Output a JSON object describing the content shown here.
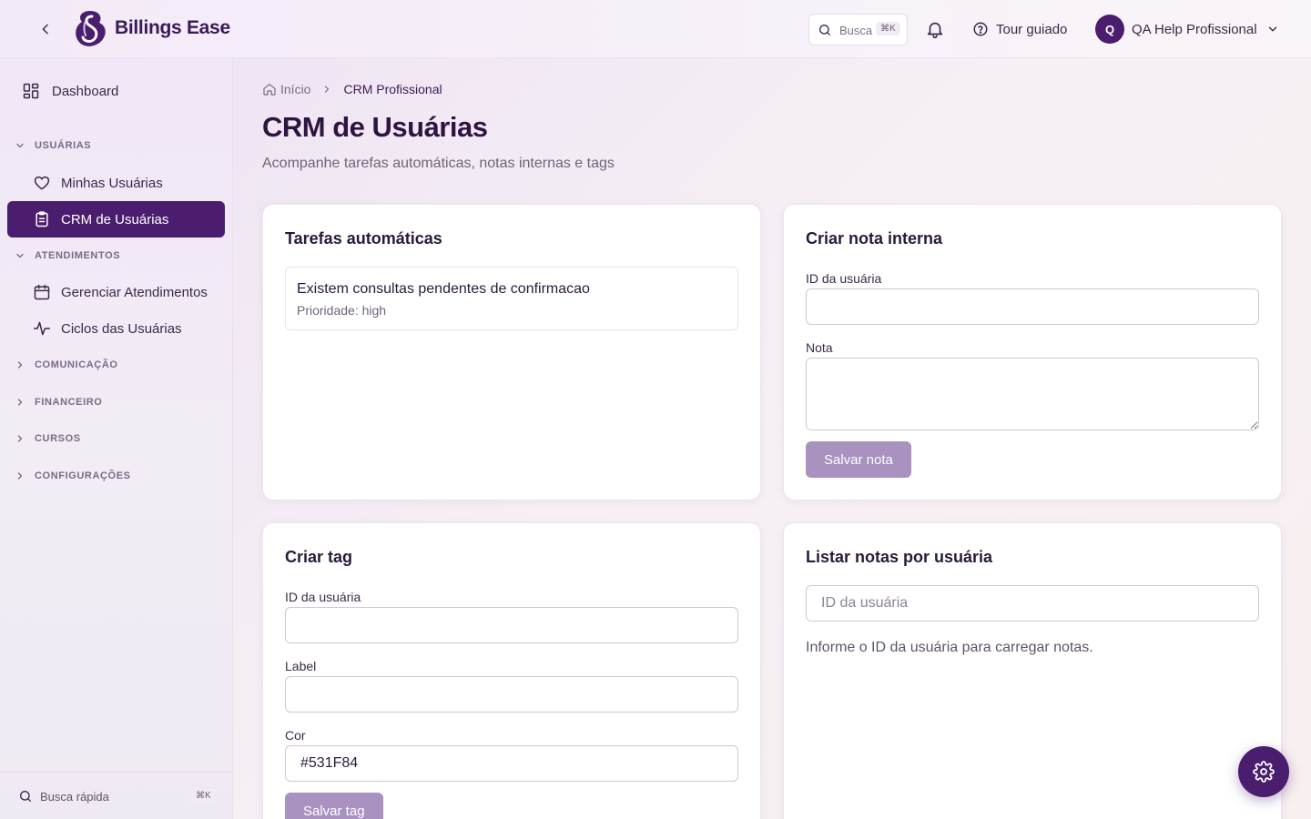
{
  "header": {
    "brand": "Billings Ease",
    "search_label": "Busca",
    "search_shortcut": "⌘K",
    "tour_label": "Tour guiado",
    "user_initial": "Q",
    "user_name": "QA Help Profissional"
  },
  "sidebar": {
    "dashboard": "Dashboard",
    "sections": {
      "usuarias": "USUÁRIAS",
      "atendimentos": "ATENDIMENTOS",
      "comunicacao": "COMUNICAÇÃO",
      "financeiro": "FINANCEIRO",
      "cursos": "CURSOS",
      "configuracoes": "CONFIGURAÇÕES"
    },
    "items": {
      "minhas_usuarias": "Minhas Usuárias",
      "crm_usuarias": "CRM de Usuárias",
      "gerenciar_atendimentos": "Gerenciar Atendimentos",
      "ciclos_usuarias": "Ciclos das Usuárias"
    },
    "quick_search": "Busca rápida",
    "quick_search_shortcut": "⌘K"
  },
  "breadcrumb": {
    "home": "Início",
    "current": "CRM Profissional"
  },
  "page": {
    "title": "CRM de Usuárias",
    "subtitle": "Acompanhe tarefas automáticas, notas internas e tags"
  },
  "tasks_card": {
    "title": "Tarefas automáticas",
    "items": [
      {
        "title": "Existem consultas pendentes de confirmacao",
        "priority": "Prioridade: high"
      }
    ]
  },
  "note_card": {
    "title": "Criar nota interna",
    "user_id_label": "ID da usuária",
    "user_id_value": "",
    "note_label": "Nota",
    "note_value": "",
    "save_label": "Salvar nota"
  },
  "tag_card": {
    "title": "Criar tag",
    "user_id_label": "ID da usuária",
    "user_id_value": "",
    "label_label": "Label",
    "label_value": "",
    "color_label": "Cor",
    "color_value": "#531F84",
    "save_label": "Salvar tag"
  },
  "list_notes_card": {
    "title": "Listar notas por usuária",
    "user_id_placeholder": "ID da usuária",
    "empty_hint": "Informe o ID da usuária para carregar notas."
  },
  "colors": {
    "brand_primary": "#4B1D6F",
    "button_disabled": "#A991C0"
  }
}
